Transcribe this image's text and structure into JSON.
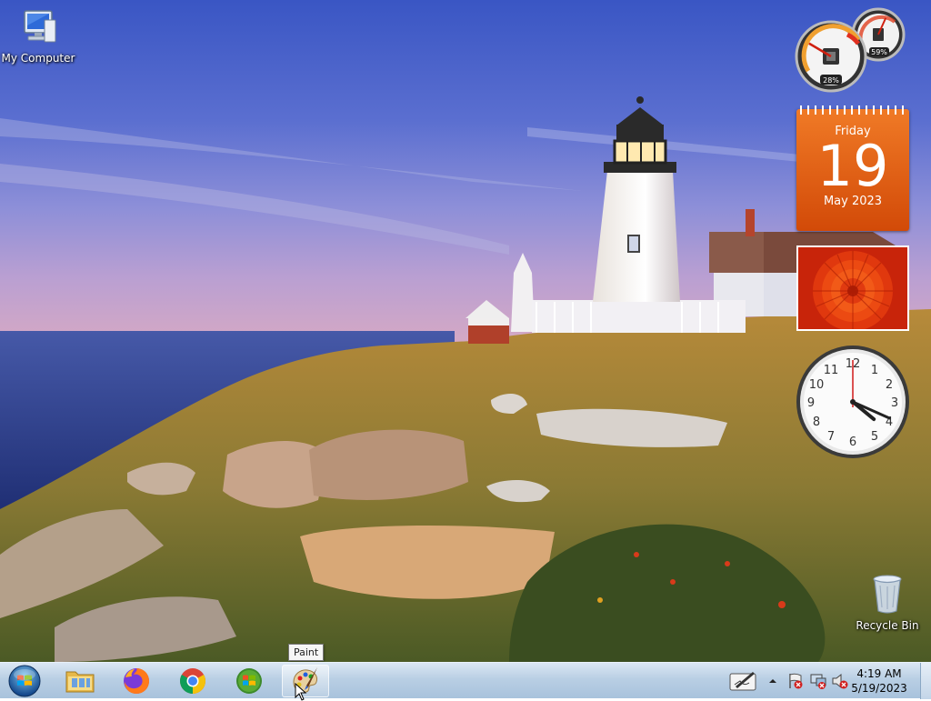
{
  "desktop": {
    "icons": [
      {
        "label": "My Computer",
        "icon": "computer-icon"
      },
      {
        "label": "Recycle Bin",
        "icon": "recycle-bin-icon"
      }
    ]
  },
  "gadgets": {
    "cpu_meter": {
      "cpu_label": "28%",
      "memory_label": "59%",
      "cpu_percent": 28,
      "memory_percent": 59
    },
    "calendar": {
      "weekday": "Friday",
      "day": "19",
      "month_year": "May 2023"
    },
    "slideshow": {
      "subject": "flower-photo"
    },
    "clock": {
      "hour": 4,
      "minute": 19,
      "second": 0
    }
  },
  "tooltip": {
    "text": "Paint"
  },
  "taskbar": {
    "start": {
      "icon": "windows-orb-icon"
    },
    "pinned": [
      {
        "name": "file-explorer",
        "icon": "folder-icon"
      },
      {
        "name": "firefox",
        "icon": "firefox-icon"
      },
      {
        "name": "chrome",
        "icon": "chrome-icon"
      },
      {
        "name": "windows-media",
        "icon": "windows-logo-icon"
      },
      {
        "name": "paint",
        "icon": "paint-icon"
      }
    ],
    "tray": {
      "time": "4:19 AM",
      "date": "5/19/2023"
    }
  }
}
